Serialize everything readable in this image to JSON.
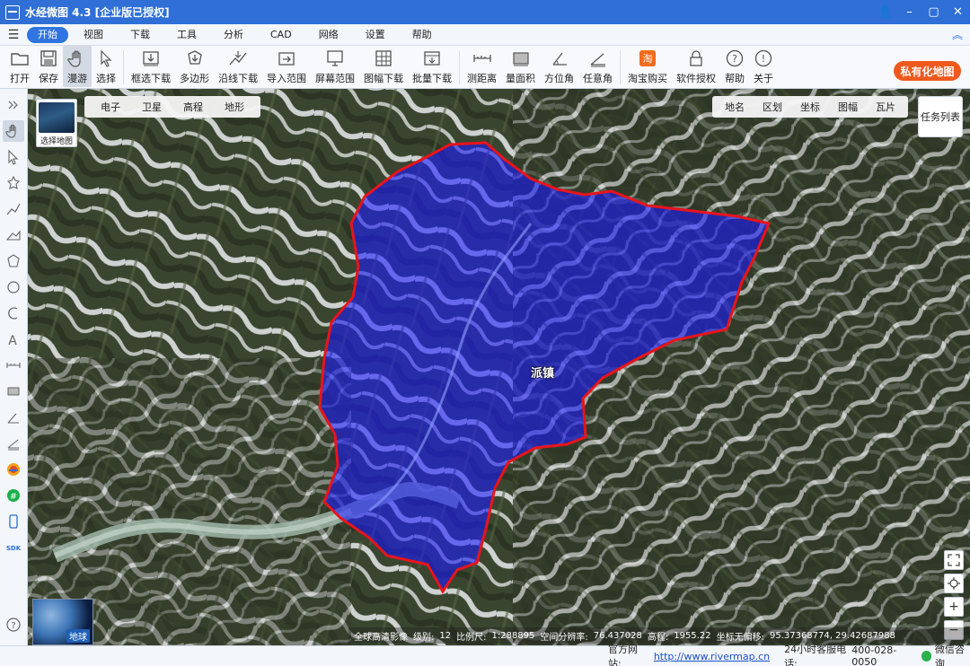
{
  "window": {
    "title": "水经微图 4.3 [企业版已授权]",
    "controls": [
      "👤",
      "–",
      "▢",
      "✕"
    ]
  },
  "menu": {
    "items": [
      {
        "label": "开始",
        "active": true
      },
      {
        "label": "视图"
      },
      {
        "label": "下载"
      },
      {
        "label": "工具"
      },
      {
        "label": "分析"
      },
      {
        "label": "CAD"
      },
      {
        "label": "网络"
      },
      {
        "label": "设置"
      },
      {
        "label": "帮助"
      }
    ]
  },
  "ribbon": {
    "tools": [
      {
        "label": "打开",
        "icon": "folder-icon",
        "caret": true
      },
      {
        "label": "保存",
        "icon": "save-icon"
      },
      {
        "label": "漫游",
        "icon": "hand-icon",
        "selected": true
      },
      {
        "label": "选择",
        "icon": "pointer-icon"
      },
      {
        "label": "框选下载",
        "icon": "box-download-icon"
      },
      {
        "label": "多边形",
        "icon": "polygon-download-icon"
      },
      {
        "label": "沿线下载",
        "icon": "line-download-icon"
      },
      {
        "label": "导入范围",
        "icon": "import-range-icon"
      },
      {
        "label": "屏幕范围",
        "icon": "screen-range-icon"
      },
      {
        "label": "图幅下载",
        "icon": "sheet-download-icon",
        "caret": true
      },
      {
        "label": "批量下载",
        "icon": "batch-download-icon"
      },
      {
        "label": "测距离",
        "icon": "measure-distance-icon"
      },
      {
        "label": "量面积",
        "icon": "measure-area-icon"
      },
      {
        "label": "方位角",
        "icon": "azimuth-icon"
      },
      {
        "label": "任意角",
        "icon": "angle-icon"
      },
      {
        "label": "淘宝购买",
        "icon": "taobao-icon"
      },
      {
        "label": "软件授权",
        "icon": "lock-icon"
      },
      {
        "label": "帮助",
        "icon": "help-icon"
      },
      {
        "label": "关于",
        "icon": "info-icon"
      }
    ],
    "private_map_label": "私有化地图"
  },
  "map": {
    "thumb_label": "选择地图",
    "map_types": [
      "电子",
      "卫星",
      "高程",
      "地形"
    ],
    "overlays": [
      "地名",
      "区划",
      "坐标",
      "图幅",
      "瓦片"
    ],
    "task_list_label": "任务列表",
    "town_label": "派镇",
    "globe_label": "地球",
    "info": {
      "source": "全球高清影像",
      "level_label": "级别:",
      "level": "12",
      "scale_label": "比例尺:",
      "scale": "1:288895",
      "resolution_label": "空间分辨率:",
      "resolution": "76.437028",
      "elevation_label": "高程:",
      "elevation": "1955.22",
      "coord_label": "坐标无偏移:",
      "coord": "95.37368774, 29.42687988"
    }
  },
  "status": {
    "site_label": "官方网站:",
    "site_url": "http://www.rivermap.cn",
    "phone_label": "24小时客服电话:",
    "phone": "400-028-0050",
    "chat_label": "微信咨询"
  },
  "colors": {
    "titlebar": "#2f6fd6",
    "accent": "#2f74e0",
    "private_btn": "#f0591e",
    "boundary": "#e8141c",
    "fill": "#1a1aff"
  }
}
